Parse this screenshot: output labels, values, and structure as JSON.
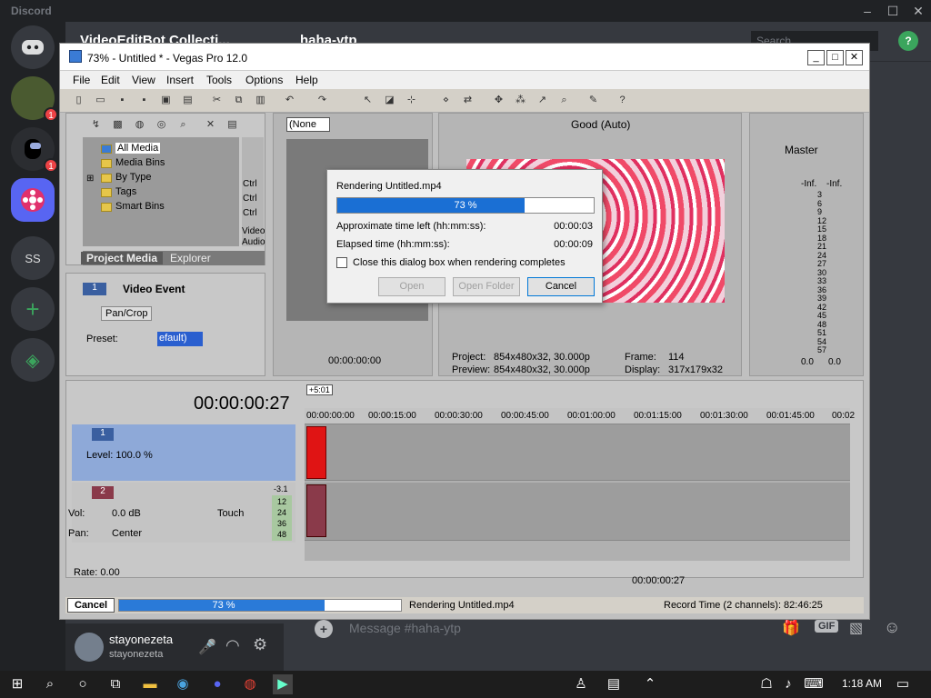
{
  "discord": {
    "brand": "Discord",
    "servers": {
      "ss": "SS",
      "badge1": "1",
      "badge2": "1"
    },
    "channel_header": {
      "channel_name": "haha-ytp",
      "server_name": "VideoEditBot Collecti...",
      "search_placeholder": "Search"
    },
    "message_placeholder": "Message #haha-ytp",
    "gif_label": "GIF",
    "user": {
      "name": "stayonezeta",
      "tag": "stayonezeta"
    }
  },
  "vegas": {
    "title": "73% - Untitled * - Vegas Pro 12.0",
    "menu": [
      "File",
      "Edit",
      "View",
      "Insert",
      "Tools",
      "Options",
      "Help"
    ],
    "media_tree": [
      "All Media",
      "Media Bins",
      "By Type",
      "Tags",
      "Smart Bins"
    ],
    "tabs": [
      "Project Media",
      "Explorer"
    ],
    "side_labels": [
      "Ctrl",
      "Ctrl",
      "Ctrl",
      "Video",
      "Audio"
    ],
    "event": {
      "title": "Video Event",
      "track_num": "1",
      "pancrop": "Pan/Crop",
      "preset_label": "Preset:",
      "preset_value": "efault)"
    },
    "trimmer": {
      "none_option": "(None",
      "timecode": "00:00:00:00"
    },
    "preview": {
      "quality": "Good (Auto)",
      "project_label": "Project:",
      "project_value": "854x480x32, 30.000p",
      "preview_label": "Preview:",
      "preview_value": "854x480x32, 30.000p",
      "frame_label": "Frame:",
      "frame_value": "114",
      "display_label": "Display:",
      "display_value": "317x179x32"
    },
    "master": {
      "title": "Master",
      "inf_left": "-Inf.",
      "inf_right": "-Inf.",
      "scale": [
        "3",
        "6",
        "9",
        "12",
        "15",
        "18",
        "21",
        "24",
        "27",
        "30",
        "33",
        "36",
        "39",
        "42",
        "45",
        "48",
        "51",
        "54",
        "57"
      ],
      "bottom_left": "0.0",
      "bottom_right": "0.0"
    },
    "timeline": {
      "time": "00:00:00:27",
      "marker": "+5:01",
      "ruler": [
        "00:00:00:00",
        "00:00:15:00",
        "00:00:30:00",
        "00:00:45:00",
        "00:01:00:00",
        "00:01:15:00",
        "00:01:30:00",
        "00:01:45:00",
        "00:02"
      ],
      "track1": {
        "num": "1",
        "level": "Level: 100.0 %"
      },
      "track2": {
        "num": "2",
        "vol_label": "Vol:",
        "vol_value": "0.0 dB",
        "pan_label": "Pan:",
        "pan_value": "Center",
        "touch": "Touch",
        "meter_top": "-3.1",
        "meter": [
          "12",
          "24",
          "36",
          "48"
        ]
      },
      "rate": "Rate: 0.00",
      "transport_time": "00:00:00:27"
    },
    "status": {
      "cancel": "Cancel",
      "percent": "73 %",
      "progress": 0.73,
      "rendering": "Rendering Untitled.mp4",
      "record": "Record Time (2 channels): 82:46:25"
    }
  },
  "dialog": {
    "title": "Rendering Untitled.mp4",
    "percent": "73 %",
    "progress": 0.73,
    "approx_label": "Approximate time left (hh:mm:ss):",
    "approx_value": "00:00:03",
    "elapsed_label": "Elapsed time (hh:mm:ss):",
    "elapsed_value": "00:00:09",
    "checkbox_label": "Close this dialog box when rendering completes",
    "open_button": "Open",
    "open_folder_button": "Open Folder",
    "cancel_button": "Cancel"
  },
  "taskbar": {
    "time": "1:18 AM"
  }
}
